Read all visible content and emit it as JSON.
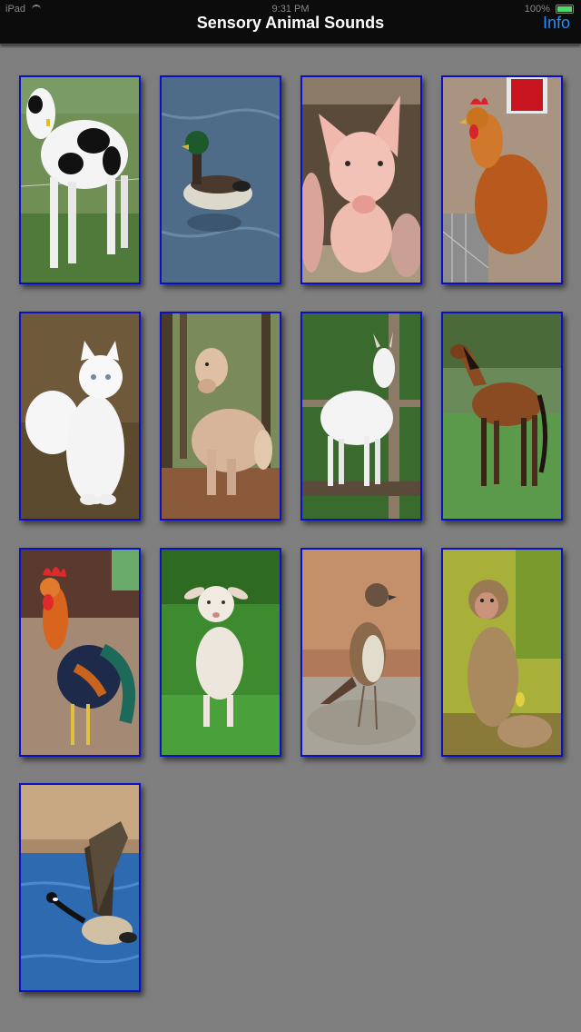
{
  "status": {
    "device": "iPad",
    "time": "9:31 PM",
    "battery": "100%"
  },
  "nav": {
    "title": "Sensory Animal Sounds",
    "info_label": "Info"
  },
  "animals": [
    {
      "name": "cow"
    },
    {
      "name": "duck"
    },
    {
      "name": "pig"
    },
    {
      "name": "hen"
    },
    {
      "name": "cat"
    },
    {
      "name": "dog"
    },
    {
      "name": "goat"
    },
    {
      "name": "horse"
    },
    {
      "name": "rooster"
    },
    {
      "name": "lamb"
    },
    {
      "name": "sparrow"
    },
    {
      "name": "monkey"
    },
    {
      "name": "goose"
    }
  ]
}
